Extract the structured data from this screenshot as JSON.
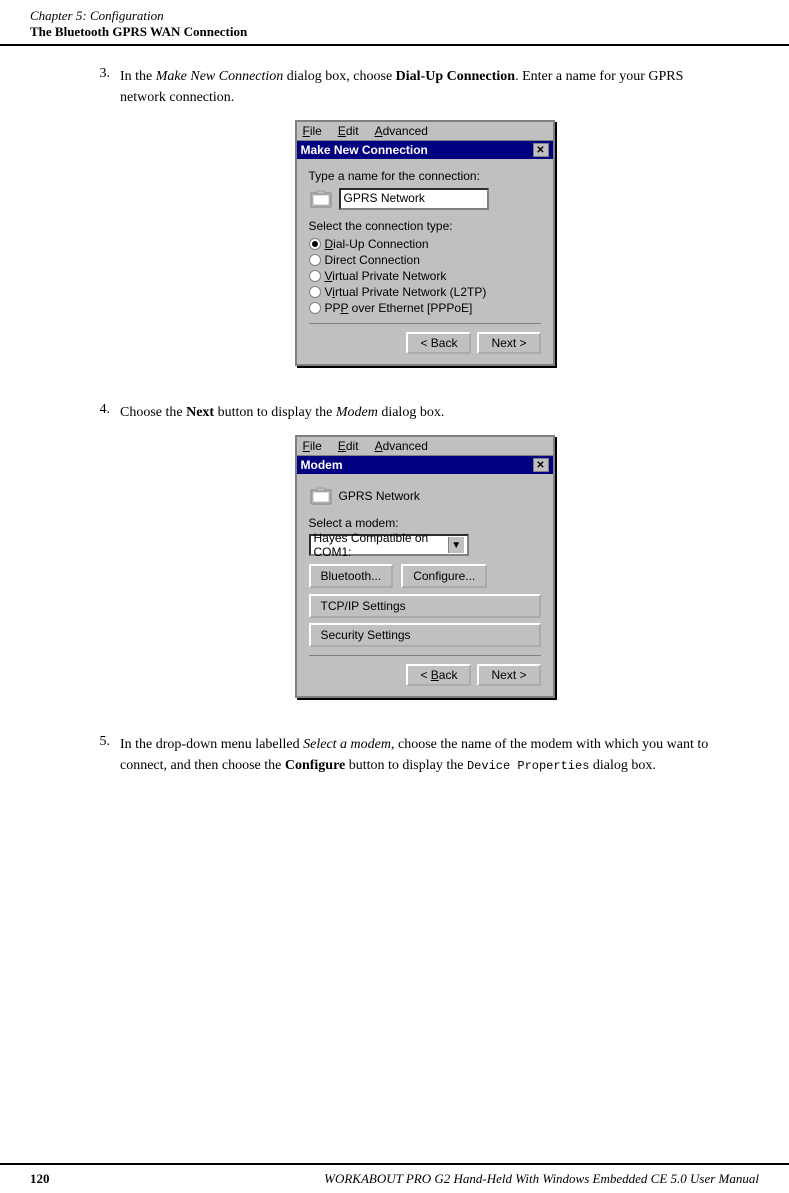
{
  "header": {
    "chapter": "Chapter  5:  Configuration",
    "section": "The Bluetooth GPRS WAN Connection"
  },
  "steps": [
    {
      "number": "3.",
      "text_parts": [
        {
          "text": "In the ",
          "style": "normal"
        },
        {
          "text": "Make New Connection",
          "style": "italic"
        },
        {
          "text": " dialog box, choose ",
          "style": "normal"
        },
        {
          "text": "Dial-Up Connection",
          "style": "bold"
        },
        {
          "text": ". Enter a name for your GPRS network connection.",
          "style": "normal"
        }
      ]
    },
    {
      "number": "4.",
      "text_parts": [
        {
          "text": "Choose the ",
          "style": "normal"
        },
        {
          "text": "Next",
          "style": "bold"
        },
        {
          "text": " button to display the ",
          "style": "normal"
        },
        {
          "text": "Modem",
          "style": "italic"
        },
        {
          "text": " dialog box.",
          "style": "normal"
        }
      ]
    },
    {
      "number": "5.",
      "text_parts": [
        {
          "text": "In the drop-down menu labelled ",
          "style": "normal"
        },
        {
          "text": "Select a modem",
          "style": "italic"
        },
        {
          "text": ", choose the name of the modem with which you want to connect, and then choose the ",
          "style": "normal"
        },
        {
          "text": "Configure",
          "style": "bold"
        },
        {
          "text": " button to display the ",
          "style": "normal"
        },
        {
          "text": "Device  Properties",
          "style": "code"
        },
        {
          "text": " dialog box.",
          "style": "normal"
        }
      ]
    }
  ],
  "dialog1": {
    "menu_items": [
      "File",
      "Edit",
      "Advanced"
    ],
    "title": "Make New Connection",
    "name_label": "Type a name for the connection:",
    "name_value": "GPRS Network",
    "type_label": "Select the connection type:",
    "radio_options": [
      {
        "label": "Dial-Up Connection",
        "selected": true
      },
      {
        "label": "Direct Connection",
        "selected": false
      },
      {
        "label": "Virtual Private Network",
        "selected": false
      },
      {
        "label": "Virtual Private Network (L2TP)",
        "selected": false
      },
      {
        "label": "PPP over Ethernet [PPPoE]",
        "selected": false
      }
    ],
    "btn_back": "< Back",
    "btn_next": "Next >"
  },
  "dialog2": {
    "menu_items": [
      "File",
      "Edit",
      "Advanced"
    ],
    "title": "Modem",
    "network_name": "GPRS Network",
    "modem_label": "Select a modem:",
    "modem_value": "Hayes Compatible on COM1:",
    "btn_bluetooth": "Bluetooth...",
    "btn_configure": "Configure...",
    "btn_tcp": "TCP/IP Settings",
    "btn_security": "Security Settings",
    "btn_back": "< Back",
    "btn_next": "Next >"
  },
  "footer": {
    "left": "120",
    "right": "WORKABOUT PRO G2 Hand-Held With Windows Embedded CE 5.0 User Manual"
  }
}
